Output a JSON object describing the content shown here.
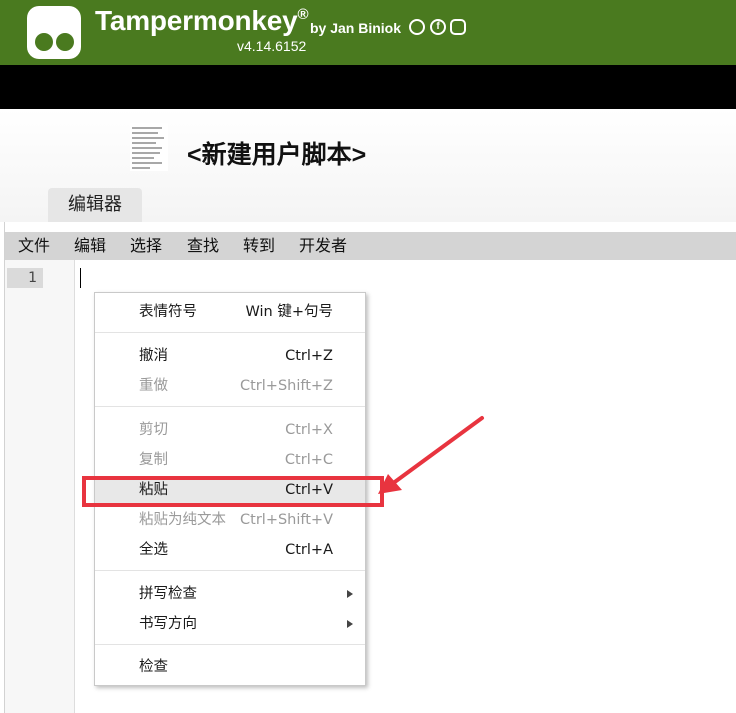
{
  "header": {
    "app_name": "Tampermonkey",
    "registered": "®",
    "byline": "by Jan Biniok",
    "version": "v4.14.6152",
    "social_icons": [
      "github-icon",
      "facebook-icon",
      "instagram-icon"
    ],
    "brand_color": "#4a7a1f"
  },
  "script": {
    "name": "<新建用户脚本>",
    "icon": "script-icon"
  },
  "tabs": [
    {
      "label": "编辑器",
      "active": true
    }
  ],
  "menubar": {
    "items": [
      "文件",
      "编辑",
      "选择",
      "查找",
      "转到",
      "开发者"
    ]
  },
  "editor": {
    "line_numbers": [
      "1"
    ]
  },
  "context_menu": {
    "items": [
      {
        "label": "表情符号",
        "shortcut": "Win 键+句号",
        "enabled": true
      },
      {
        "label": "撤消",
        "shortcut": "Ctrl+Z",
        "enabled": true
      },
      {
        "label": "重做",
        "shortcut": "Ctrl+Shift+Z",
        "enabled": false
      },
      {
        "label": "剪切",
        "shortcut": "Ctrl+X",
        "enabled": false
      },
      {
        "label": "复制",
        "shortcut": "Ctrl+C",
        "enabled": false
      },
      {
        "label": "粘贴",
        "shortcut": "Ctrl+V",
        "enabled": true,
        "highlighted": true
      },
      {
        "label": "粘贴为纯文本",
        "shortcut": "Ctrl+Shift+V",
        "enabled": false
      },
      {
        "label": "全选",
        "shortcut": "Ctrl+A",
        "enabled": true
      },
      {
        "label": "拼写检查",
        "has_submenu": true,
        "enabled": true
      },
      {
        "label": "书写方向",
        "has_submenu": true,
        "enabled": true
      },
      {
        "label": "检查",
        "enabled": true
      }
    ]
  },
  "annotation": {
    "color": "#e8343f",
    "target": "粘贴"
  }
}
